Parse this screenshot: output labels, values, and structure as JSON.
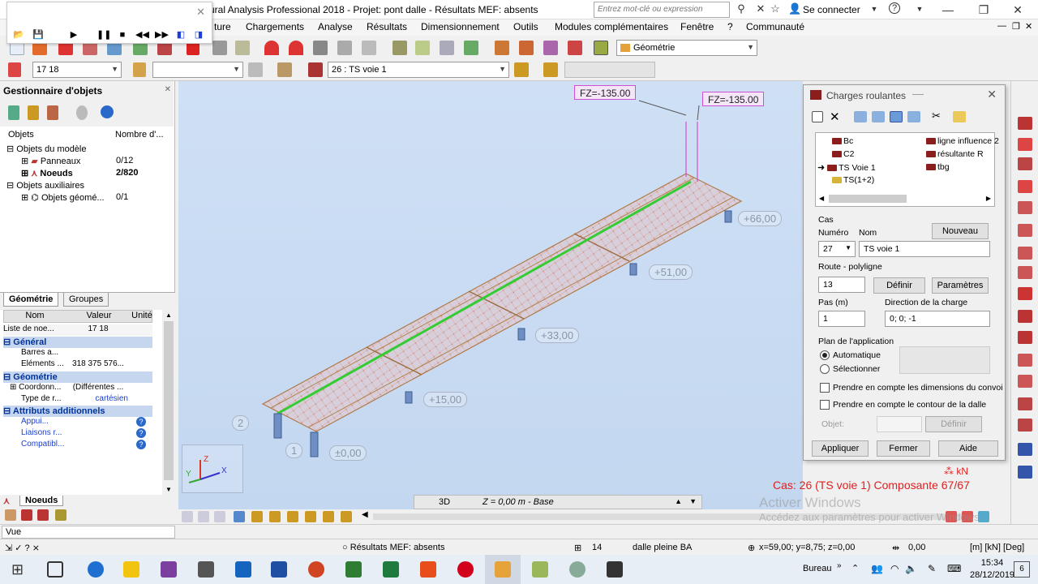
{
  "window": {
    "title": "ural Analysis Professional 2018 - Projet: pont dalle - Résultats MEF: absents",
    "search_placeholder": "Entrez mot-clé ou expression",
    "connect_label": "Se connecter"
  },
  "menu": [
    "ture",
    "Chargements",
    "Analyse",
    "Résultats",
    "Dimensionnement",
    "Outils",
    "Modules complémentaires",
    "Fenêtre",
    "?",
    "Communauté"
  ],
  "toolbar": {
    "nodes_combo": "17 18",
    "empty_combo": "",
    "case_combo": "26 : TS voie 1",
    "view_combo": "Géométrie"
  },
  "object_manager": {
    "title": "Gestionnaire d'objets",
    "col_objects": "Objets",
    "col_count": "Nombre d'...",
    "model_objects": "Objets du modèle",
    "panels_label": "Panneaux",
    "panels_count": "0/12",
    "nodes_label": "Noeuds",
    "nodes_count": "2/820",
    "aux_objects": "Objets auxiliaires",
    "geom_objects": "Objets géomé...",
    "geom_count": "0/1",
    "tabs": [
      "Géométrie",
      "Groupes"
    ]
  },
  "properties": {
    "headers": [
      "Nom",
      "Valeur",
      "Unité"
    ],
    "rows": [
      {
        "name": "Liste de noe...",
        "value": "17 18",
        "unit": ""
      },
      {
        "name": "Général",
        "section": true
      },
      {
        "name": "Barres a...",
        "value": "",
        "unit": ""
      },
      {
        "name": "Eléments ...",
        "value": "318 375 576...",
        "unit": ""
      },
      {
        "name": "Géométrie",
        "section": true
      },
      {
        "name": "Coordonn...",
        "value": "(Différentes ...",
        "unit": ""
      },
      {
        "name": "Type de r...",
        "value": "cartésien",
        "unit": ""
      },
      {
        "name": "Attributs additionnels",
        "section": true
      },
      {
        "name": "Appui...",
        "value": "",
        "unit": "?"
      },
      {
        "name": "Liaisons r...",
        "value": "",
        "unit": "?"
      },
      {
        "name": "Compatibl...",
        "value": "",
        "unit": "?"
      }
    ],
    "bottom_tab": "Noeuds",
    "vue_label": "Vue"
  },
  "viewport": {
    "fz1": "FZ=-135.00",
    "fz2": "FZ=-135.00",
    "levels": [
      "+66,00",
      "+51,00",
      "+33,00",
      "+15,00",
      "±0,00",
      "1",
      "2"
    ],
    "view_mode": "3D",
    "plane": "Z = 0,00 m - Base",
    "axis_x": "X",
    "axis_y": "Y",
    "axis_z": "Z"
  },
  "dialog": {
    "title": "Charges roulantes",
    "loads": [
      {
        "label": "Bc"
      },
      {
        "label": "C2"
      },
      {
        "label": "TS Voie 1",
        "selected": true
      },
      {
        "label": "TS(1+2)"
      },
      {
        "label": "ligne influence 2"
      },
      {
        "label": "résultante R"
      },
      {
        "label": "tbg"
      }
    ],
    "cas_label": "Cas",
    "numero_label": "Numéro",
    "nom_label": "Nom",
    "nouveau_label": "Nouveau",
    "numero_value": "27",
    "nom_value": "TS voie 1",
    "route_label": "Route - polyligne",
    "route_value": "13",
    "definir_label": "Définir",
    "parametres_label": "Paramètres",
    "pas_label": "Pas (m)",
    "pas_value": "1",
    "direction_label": "Direction de la charge",
    "direction_value": "0; 0; -1",
    "plan_label": "Plan de l'application",
    "auto_label": "Automatique",
    "select_label": "Sélectionner",
    "chk1_label": "Prendre en compte les dimensions du convoi",
    "chk2_label": "Prendre en compte le contour de la dalle",
    "objet_label": "Objet:",
    "definir2_label": "Définir",
    "appliquer_label": "Appliquer",
    "fermer_label": "Fermer",
    "aide_label": "Aide"
  },
  "case_info": {
    "unit": "kN",
    "text": "Cas: 26 (TS voie 1) Composante 67/67"
  },
  "watermark": {
    "line1": "Activer Windows",
    "line2": "Accédez aux paramètres pour activer Windows."
  },
  "statusbar": {
    "results": "Résultats MEF: absents",
    "num": "14",
    "material": "dalle pleine BA",
    "coords": "x=59,00; y=8,75; z=0,00",
    "value": "0,00",
    "units": "[m] [kN] [Deg]"
  },
  "taskbar": {
    "bureau": "Bureau",
    "time": "15:34",
    "date": "28/12/2019",
    "notif": "6"
  },
  "colors": {
    "accent": "#2a69c9",
    "load_magenta": "#d14fd1",
    "route_green": "#33cc33",
    "case_red": "#e02020"
  }
}
